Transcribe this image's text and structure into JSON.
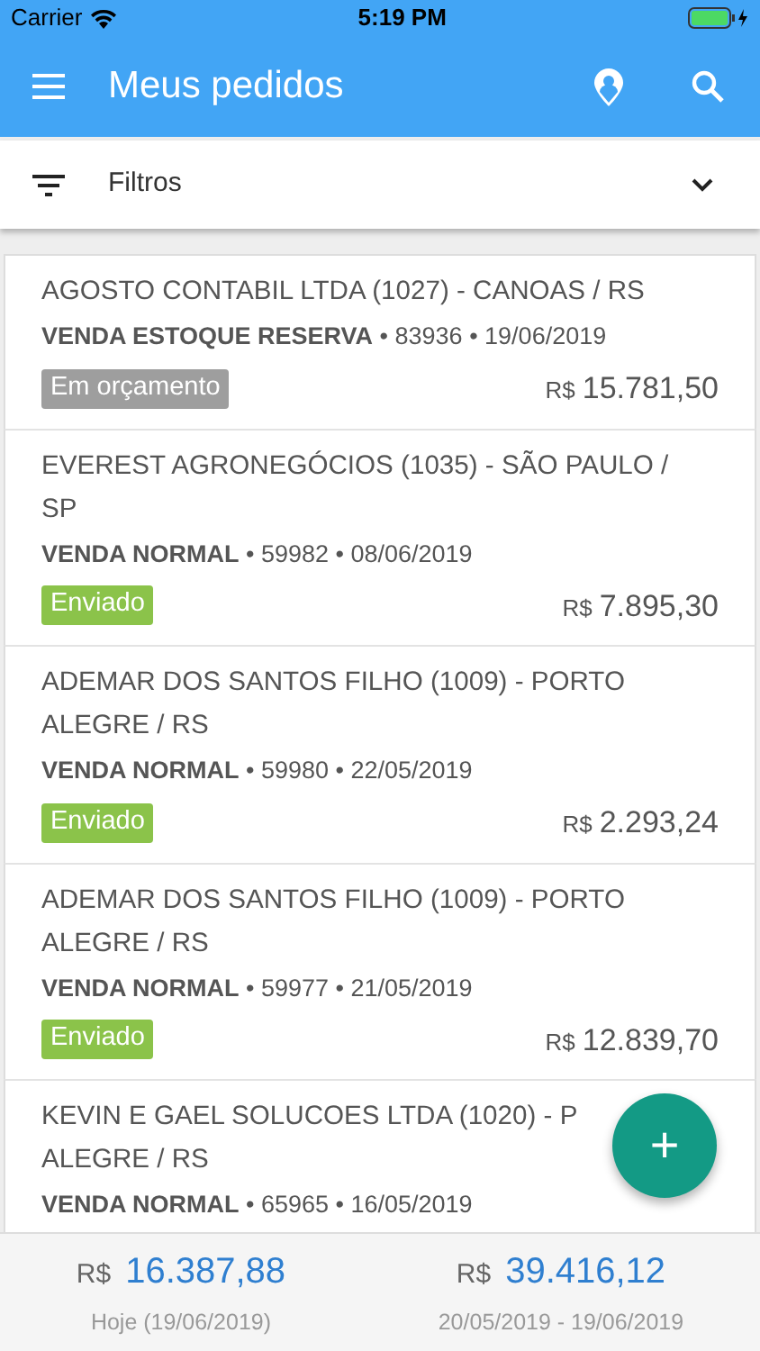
{
  "status_bar": {
    "carrier": "Carrier",
    "time": "5:19 PM"
  },
  "app_bar": {
    "title": "Meus pedidos"
  },
  "filter": {
    "label": "Filtros",
    "expanded": false
  },
  "orders": [
    {
      "lines": [
        "AGOSTO CONTABIL LTDA (1027) - CANOAS / RS"
      ],
      "meta": "**VENDA ESTOQUE RESERVA** • 83936 • 19/06/2019",
      "status": "Em orçamento",
      "color": "#9e9e9e",
      "currency": "R$",
      "amount": "15.781,50"
    },
    {
      "lines": [
        "EVEREST AGRONEGÓCIOS (1035) - SÃO PAULO /",
        "SP"
      ],
      "meta": "**VENDA NORMAL** • 59982 • 08/06/2019",
      "status": "Enviado",
      "color": "#8bc34a",
      "currency": "R$",
      "amount": "7.895,30"
    },
    {
      "lines": [
        "ADEMAR DOS SANTOS FILHO (1009) - PORTO",
        "ALEGRE / RS"
      ],
      "meta": "**VENDA NORMAL** • 59980 • 22/05/2019",
      "status": "Enviado",
      "color": "#8bc34a",
      "currency": "R$",
      "amount": "2.293,24"
    },
    {
      "lines": [
        "ADEMAR DOS SANTOS FILHO (1009) - PORTO",
        "ALEGRE / RS"
      ],
      "meta": "**VENDA NORMAL** • 59977 • 21/05/2019",
      "status": "Enviado",
      "color": "#8bc34a",
      "currency": "R$",
      "amount": "12.839,70"
    },
    {
      "lines": [
        "KEVIN E GAEL SOLUCOES LTDA (1020) - P",
        "ALEGRE / RS"
      ],
      "meta": "**VENDA NORMAL** • 65965 • 16/05/2019"
    }
  ],
  "fab": {
    "label": "+"
  },
  "totals": [
    {
      "currency": "R$",
      "amount": "16.387,88",
      "caption": "Hoje (19/06/2019)"
    },
    {
      "currency": "R$",
      "amount": "39.416,12",
      "caption": "20/05/2019 - 19/06/2019"
    }
  ]
}
